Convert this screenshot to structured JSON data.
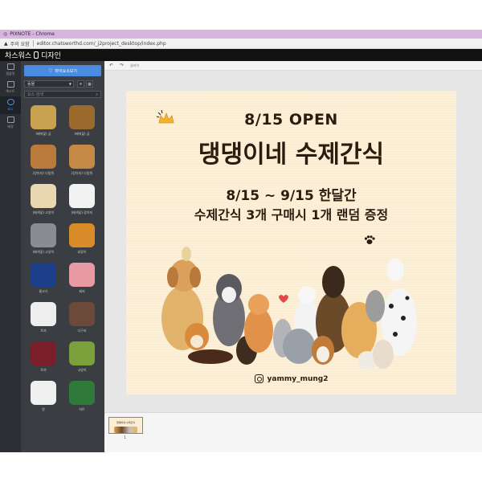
{
  "browser": {
    "window_title": "PIXNOTE - Chrome",
    "security_label": "주의 요함",
    "url": "editor.chatsworthd.com/_j2project_desktop/index.php"
  },
  "editor": {
    "brand": "차스워스",
    "brand_suffix": "디자인"
  },
  "rail": {
    "items": [
      {
        "label": "템플릿"
      },
      {
        "label": "텍스트"
      },
      {
        "label": "요소"
      },
      {
        "label": "배경"
      }
    ]
  },
  "panel": {
    "primary_button": "마이요소보기",
    "filter_value": "동물",
    "search_placeholder": "요소 검색",
    "items": [
      {
        "caption": "(배색꽃) 곰",
        "color": "#c9a24f"
      },
      {
        "caption": "(배색꽃) 곰",
        "color": "#9b6a2f"
      },
      {
        "caption": "(강아지) 다람쥐",
        "color": "#b97a3c"
      },
      {
        "caption": "(강아지) 다람쥐",
        "color": "#c48a45"
      },
      {
        "caption": "(배색꽃) 고양이",
        "color": "#e8d7b0"
      },
      {
        "caption": "(배색꽃) 강아지",
        "color": "#f2f2f2"
      },
      {
        "caption": "(배색꽃) 고양이",
        "color": "#8a8c92"
      },
      {
        "caption": "호랑이",
        "color": "#d98b2a"
      },
      {
        "caption": "물고기",
        "color": "#1d3f8a"
      },
      {
        "caption": "돼지",
        "color": "#e79aa3"
      },
      {
        "caption": "토끼",
        "color": "#eeeeee"
      },
      {
        "caption": "너구리",
        "color": "#6b4a3a"
      },
      {
        "caption": "토끼",
        "color": "#7a1f2a"
      },
      {
        "caption": "고양이",
        "color": "#7aa03a"
      },
      {
        "caption": "양",
        "color": "#f0f0f0"
      },
      {
        "caption": "하트",
        "color": "#2f7a3a"
      }
    ]
  },
  "toolbar": {
    "undo": "↶",
    "redo": "↷",
    "label": "클리어"
  },
  "design": {
    "open_line": "8/15 OPEN",
    "title": "댕댕이네 수제간식",
    "date_line": "8/15 ~ 9/15 한달간",
    "promo_line": "수제간식 3개 구매시 1개 랜덤 증정",
    "instagram": "yammy_mung2",
    "background": "#fbedd1",
    "text_color": "#2a1d10",
    "crown_color": "#f2b233"
  },
  "pages": {
    "current": "1"
  }
}
